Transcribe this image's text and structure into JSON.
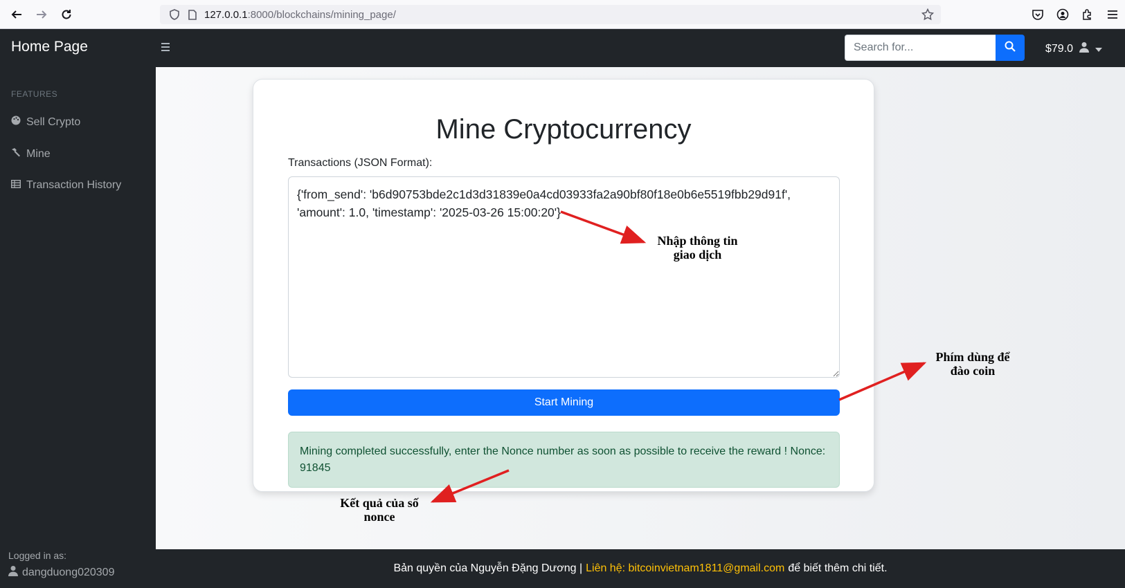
{
  "browser": {
    "url_host": "127.0.0.1",
    "url_path": ":8000/blockchains/mining_page/"
  },
  "navbar": {
    "brand": "Home Page",
    "search_placeholder": "Search for...",
    "balance": "$79.0"
  },
  "sidebar": {
    "heading": "FEATURES",
    "items": [
      {
        "label": "Sell Crypto",
        "icon": "palette-icon"
      },
      {
        "label": "Mine",
        "icon": "hammer-icon"
      },
      {
        "label": "Transaction History",
        "icon": "table-icon"
      }
    ],
    "logged_in_label": "Logged in as:",
    "username": "dangduong020309"
  },
  "main": {
    "title": "Mine Cryptocurrency",
    "tx_label": "Transactions (JSON Format):",
    "tx_value": "{'from_send': 'b6d90753bde2c1d3d31839e0a4cd03933fa2a90bf80f18e0b6e5519fbb29d91f', 'amount': 1.0, 'timestamp': '2025-03-26 15:00:20'}",
    "mine_button": "Start Mining",
    "result": "Mining completed successfully, enter the Nonce number as soon as possible to receive the reward ! Nonce: 91845"
  },
  "annotations": {
    "input_note_1": "Nhập thông tin",
    "input_note_2": "giao dịch",
    "button_note_1": "Phím dùng để",
    "button_note_2": "đào coin",
    "result_note_1": "Kết quả của số",
    "result_note_2": "nonce"
  },
  "footer": {
    "copyright": "Bản quyền của Nguyễn Đặng Dương |",
    "contact": "Liên hệ: bitcoinvietnam1811@gmail.com",
    "suffix": "để biết thêm chi tiết."
  },
  "colors": {
    "primary": "#0d6efd",
    "dark": "#212529",
    "success_bg": "#d1e7dd",
    "success_text": "#0f5132",
    "footer_link": "#ffc107",
    "arrow": "#e02020"
  }
}
